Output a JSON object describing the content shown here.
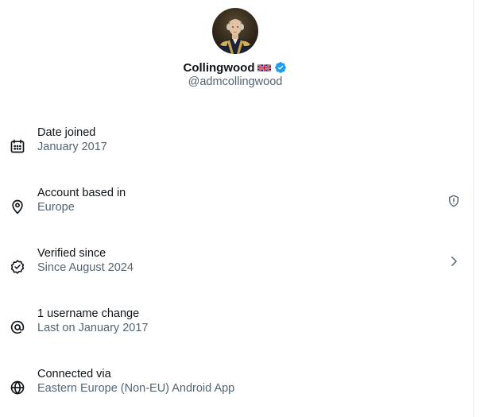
{
  "profile": {
    "display_name": "Collingwood",
    "handle": "@admcollingwood",
    "flag": "uk-flag-icon",
    "verified": "verified-badge-icon"
  },
  "rows": [
    {
      "icon": "calendar-icon",
      "label": "Date joined",
      "value": "January 2017",
      "trailing": ""
    },
    {
      "icon": "location-pin-icon",
      "label": "Account based in",
      "value": "Europe",
      "trailing": "shield-info-icon"
    },
    {
      "icon": "verified-check-icon",
      "label": "Verified since",
      "value": "Since August 2024",
      "trailing": "chevron-right-icon"
    },
    {
      "icon": "at-sign-icon",
      "label": "1 username change",
      "value": "Last on January 2017",
      "trailing": ""
    },
    {
      "icon": "globe-icon",
      "label": "Connected via",
      "value": "Eastern Europe (Non-EU) Android App",
      "trailing": ""
    }
  ],
  "colors": {
    "text_primary": "#0f1419",
    "text_secondary": "#536471",
    "verified_blue": "#1d9bf0",
    "background": "#ffffff"
  }
}
